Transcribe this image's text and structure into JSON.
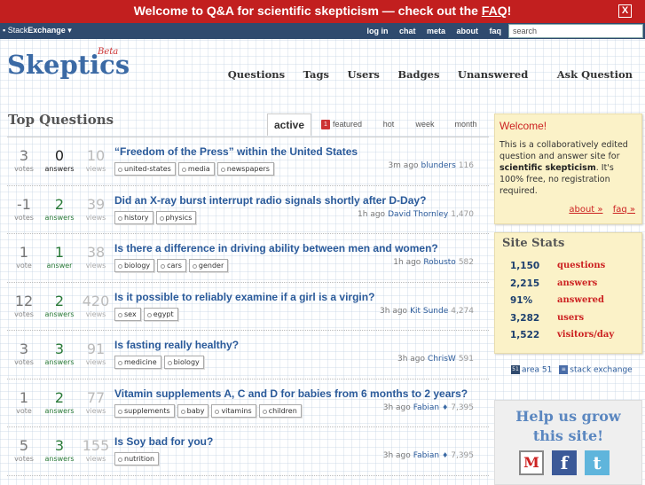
{
  "notify": {
    "text": "Welcome to Q&A for scientific skepticism — check out the ",
    "faq": "FAQ",
    "end": "!",
    "close": "X"
  },
  "topbar": {
    "brand_prefix": "Stack",
    "brand_bold": "Exchange",
    "brand_arrow": "▾",
    "links": [
      "log in",
      "chat",
      "meta",
      "about",
      "faq"
    ],
    "search_value": "search"
  },
  "header": {
    "logo": "Skeptics",
    "beta": "Beta",
    "nav": [
      "Questions",
      "Tags",
      "Users",
      "Badges",
      "Unanswered"
    ],
    "ask": "Ask Question"
  },
  "main": {
    "heading": "Top Questions",
    "tabs": [
      "active",
      "featured",
      "hot",
      "week",
      "month"
    ],
    "featured_count": "1",
    "questions": [
      {
        "votes": "3",
        "votes_label": "votes",
        "answers": "0",
        "answers_label": "answers",
        "views": "10",
        "views_label": "views",
        "title": "“Freedom of the Press” within the United States",
        "tags": [
          "united-states",
          "media",
          "newspapers"
        ],
        "time": "3m ago",
        "user": "blunders",
        "diamond": "",
        "rep": "116"
      },
      {
        "votes": "-1",
        "votes_label": "votes",
        "answers": "2",
        "answers_label": "answers",
        "views": "39",
        "views_label": "views",
        "title": "Did an X-ray burst interrupt radio signals shortly after D-Day?",
        "tags": [
          "history",
          "physics"
        ],
        "time": "1h ago",
        "user": "David Thornley",
        "diamond": "",
        "rep": "1,470"
      },
      {
        "votes": "1",
        "votes_label": "vote",
        "answers": "1",
        "answers_label": "answer",
        "views": "38",
        "views_label": "views",
        "title": "Is there a difference in driving ability between men and women?",
        "tags": [
          "biology",
          "cars",
          "gender"
        ],
        "time": "1h ago",
        "user": "Robusto",
        "diamond": "",
        "rep": "582"
      },
      {
        "votes": "12",
        "votes_label": "votes",
        "answers": "2",
        "answers_label": "answers",
        "views": "420",
        "views_label": "views",
        "title": "Is it possible to reliably examine if a girl is a virgin?",
        "tags": [
          "sex",
          "egypt"
        ],
        "time": "3h ago",
        "user": "Kit Sunde",
        "diamond": "",
        "rep": "4,274"
      },
      {
        "votes": "3",
        "votes_label": "votes",
        "answers": "3",
        "answers_label": "answers",
        "views": "91",
        "views_label": "views",
        "title": "Is fasting really healthy?",
        "tags": [
          "medicine",
          "biology"
        ],
        "time": "3h ago",
        "user": "ChrisW",
        "diamond": "",
        "rep": "591"
      },
      {
        "votes": "1",
        "votes_label": "vote",
        "answers": "2",
        "answers_label": "answers",
        "views": "77",
        "views_label": "views",
        "title": "Vitamin supplements A, C and D for babies from 6 months to 2 years?",
        "tags": [
          "supplements",
          "baby",
          "vitamins",
          "children"
        ],
        "time": "3h ago",
        "user": "Fabian",
        "diamond": "♦",
        "rep": "7,395"
      },
      {
        "votes": "5",
        "votes_label": "votes",
        "answers": "3",
        "answers_label": "answers",
        "views": "155",
        "views_label": "views",
        "title": "Is Soy bad for you?",
        "tags": [
          "nutrition"
        ],
        "time": "3h ago",
        "user": "Fabian",
        "diamond": "♦",
        "rep": "7,395"
      }
    ]
  },
  "sidebar": {
    "welcome_title": "Welcome!",
    "welcome_text_1": "This is a collaboratively edited question and answer site for ",
    "welcome_bold": "scientific skepticism",
    "welcome_text_2": ". It's 100% free, no registration required.",
    "about_link": "about »",
    "faq_link": "faq »",
    "stats_title": "Site Stats",
    "stats": [
      {
        "value": "1,150",
        "label": "questions"
      },
      {
        "value": "2,215",
        "label": "answers"
      },
      {
        "value": "91%",
        "label": "answered"
      },
      {
        "value": "3,282",
        "label": "users"
      },
      {
        "value": "1,522",
        "label": "visitors/day"
      }
    ],
    "area51": "area 51",
    "stackexchange": "stack exchange",
    "help_line1": "Help us grow",
    "help_line2": "this site!",
    "social_icons": [
      "gmail-icon",
      "facebook-icon",
      "twitter-icon"
    ]
  }
}
